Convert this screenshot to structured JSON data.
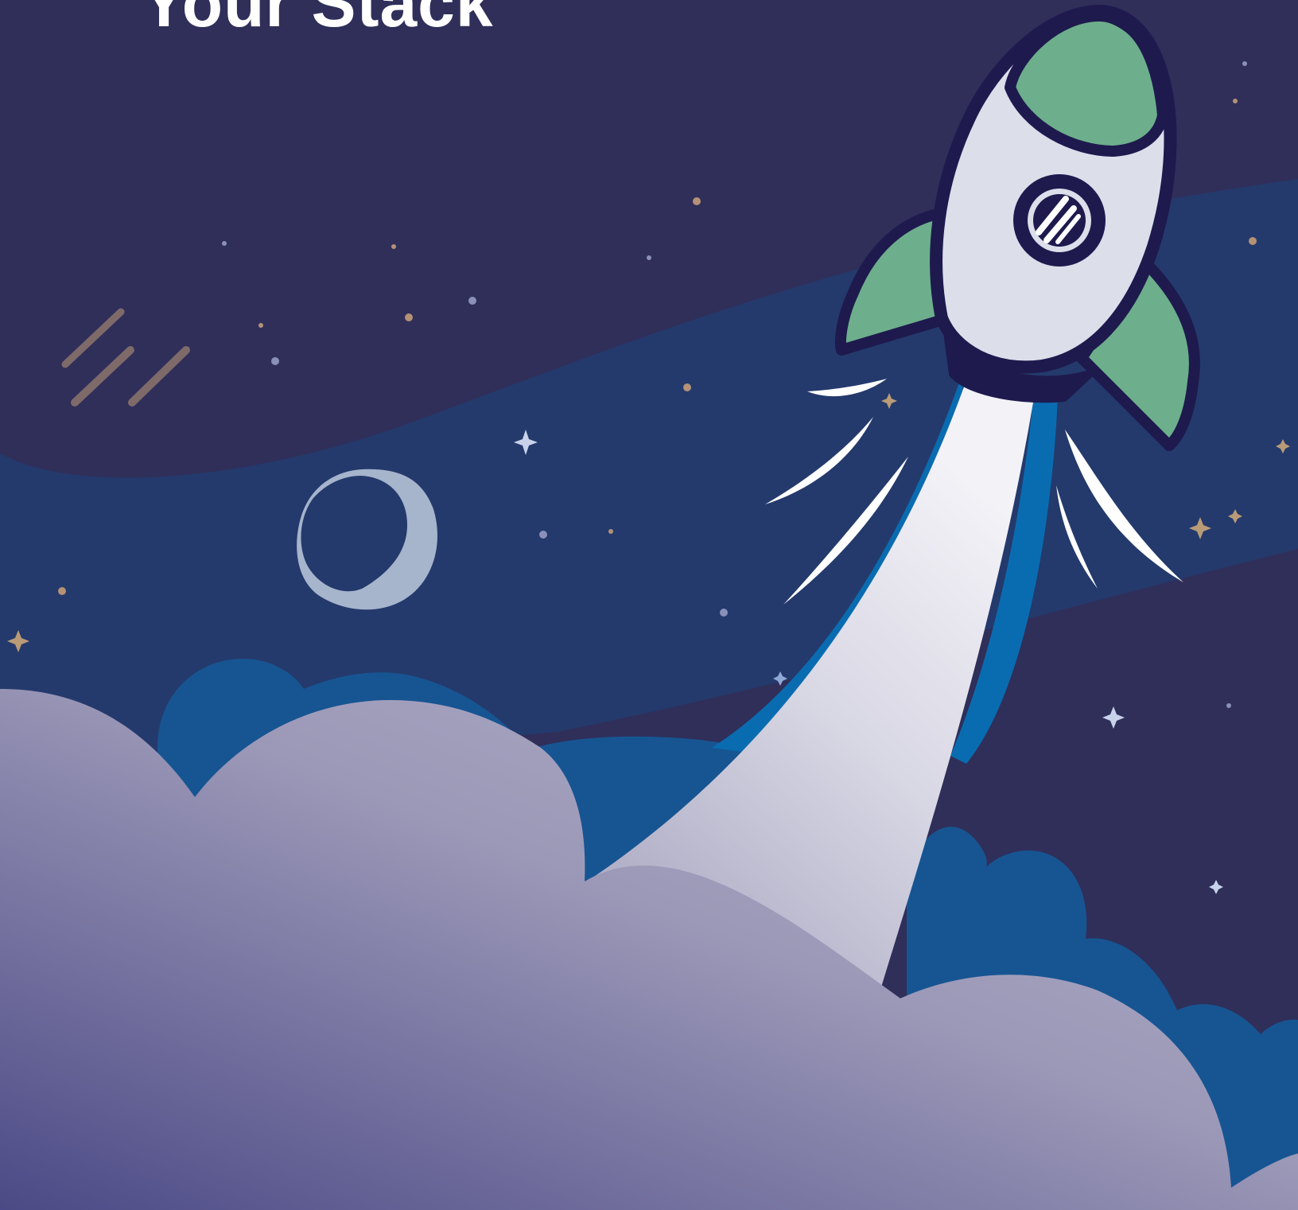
{
  "headline": {
    "text": "Your Stack"
  },
  "colors": {
    "sky_top": "#2f2f5a",
    "sky_band": "#243a6c",
    "cloud_back": "#175592",
    "cloud_front_dark": "#514f88",
    "cloud_front_light": "#aaa8c4",
    "rocket_body": "#dcdeea",
    "rocket_outline": "#1e1a4e",
    "rocket_green": "#6daf8c",
    "exhaust_blue": "#0a6cb0",
    "moon": "#a6b4cc",
    "star_gold": "#b99b77",
    "star_blue": "#8fa9d6"
  },
  "icons": [
    "rocket-icon",
    "moon-icon",
    "comet-icon",
    "star-icon",
    "cloud-icon",
    "logo-badge-icon"
  ]
}
